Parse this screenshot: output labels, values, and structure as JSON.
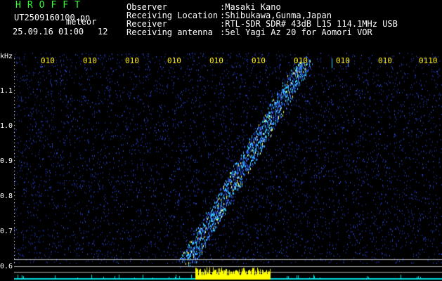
{
  "header": {
    "title": "HROFFT",
    "filename": "UT2509160100.pn",
    "label": "meteor",
    "datetime": "25.09.16 01:00",
    "count": "12"
  },
  "meta": [
    {
      "key": "Observer",
      "value": ":Masaki Kano"
    },
    {
      "key": "Receiving Location",
      "value": ":Shibukawa,Gunma,Japan"
    },
    {
      "key": "Receiver",
      "value": ":RTL-SDR SDR# 43dB L15 114.1MHz USB"
    },
    {
      "key": "Receiving antenna",
      "value": ":5el Yagi Az 20 for Aomori VOR"
    }
  ],
  "axis": {
    "y_unit": "kHz",
    "y_ticks": [
      "1.1",
      "1.0",
      "0.9",
      "0.8",
      "0.7",
      "0.6"
    ],
    "x_ticks": [
      "010",
      "010",
      "010",
      "010",
      "010",
      "010",
      "010",
      "010",
      "010",
      "0110"
    ]
  },
  "colors": {
    "background": "#000000",
    "noise": "#1a2a8a",
    "signal": "#33ccff",
    "burst": "#ffff00",
    "baseline": "#00e0e0",
    "grid_line": "#b0b0b0",
    "tick_label": "#ffee00",
    "title": "#33ff33"
  }
}
